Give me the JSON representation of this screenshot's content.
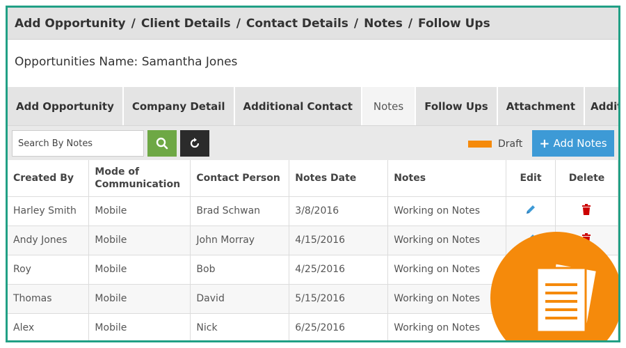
{
  "breadcrumb": {
    "items": [
      "Add Opportunity",
      "Client Details",
      "Contact Details",
      "Notes",
      "Follow Ups"
    ],
    "separator": "/"
  },
  "opportunity": {
    "label": "Opportunities Name:",
    "name": "Samantha Jones"
  },
  "tabs": [
    {
      "label": "Add Opportunity",
      "active": false
    },
    {
      "label": "Company Detail",
      "active": false
    },
    {
      "label": "Additional Contact",
      "active": false
    },
    {
      "label": "Notes",
      "active": true
    },
    {
      "label": "Follow Ups",
      "active": false
    },
    {
      "label": "Attachment",
      "active": false
    },
    {
      "label": "Additional Owner",
      "active": false
    }
  ],
  "toolbar": {
    "search_placeholder": "Search By Notes",
    "search_icon": "search-icon",
    "refresh_icon": "refresh-icon",
    "legend_label": "Draft",
    "add_label": "Add Notes"
  },
  "table": {
    "headers": {
      "created_by": "Created By",
      "mode_line1": "Mode of",
      "mode_line2": "Communication",
      "contact_person": "Contact Person",
      "notes_date": "Notes Date",
      "notes": "Notes",
      "edit": "Edit",
      "delete": "Delete"
    },
    "rows": [
      {
        "created_by": "Harley Smith",
        "mode": "Mobile",
        "contact": "Brad Schwan",
        "date": "3/8/2016",
        "notes": "Working on Notes"
      },
      {
        "created_by": "Andy Jones",
        "mode": "Mobile",
        "contact": "John Morray",
        "date": "4/15/2016",
        "notes": "Working on Notes"
      },
      {
        "created_by": "Roy",
        "mode": "Mobile",
        "contact": "Bob",
        "date": "4/25/2016",
        "notes": "Working on Notes"
      },
      {
        "created_by": "Thomas",
        "mode": "Mobile",
        "contact": "David",
        "date": "5/15/2016",
        "notes": "Working on Notes"
      },
      {
        "created_by": "Alex",
        "mode": "Mobile",
        "contact": "Nick",
        "date": "6/25/2016",
        "notes": "Working on Notes"
      }
    ]
  },
  "colors": {
    "frame": "#21a085",
    "search_button": "#6ea845",
    "refresh_button": "#2b2b2b",
    "draft": "#f58a0b",
    "add_button": "#3d9ad6",
    "edit_icon": "#3d9ad6",
    "delete_icon": "#cc0000"
  },
  "badge_icon": "documents-icon"
}
